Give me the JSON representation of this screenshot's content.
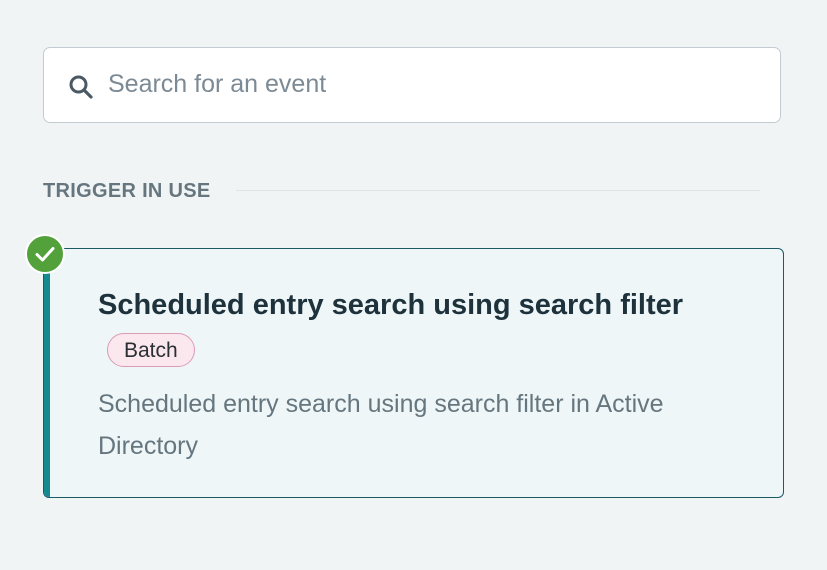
{
  "search": {
    "placeholder": "Search for an event",
    "value": "",
    "icon": "search-icon"
  },
  "section": {
    "title": "TRIGGER IN USE"
  },
  "trigger_card": {
    "status_icon": "check-icon",
    "title": "Scheduled entry search using search filter",
    "badge": "Batch",
    "description": "Scheduled entry search using search filter in Active Directory",
    "selected": true
  },
  "colors": {
    "page_background": "#f1f4f5",
    "card_background": "#eef6f8",
    "card_accent": "#138990",
    "card_border": "#1b5a66",
    "check_green": "#52a13a",
    "badge_border": "#dc9bb4",
    "badge_background": "#fbe7ee"
  }
}
